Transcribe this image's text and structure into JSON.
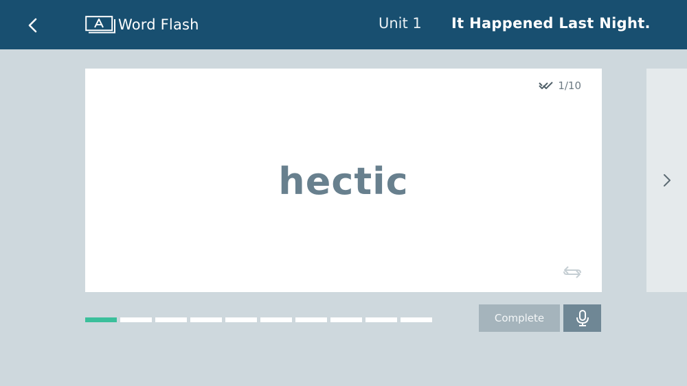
{
  "header": {
    "app_title": "Word Flash",
    "unit_label": "Unit 1",
    "unit_title": "It Happened Last Night.",
    "icons": {
      "back": "chevron-left-icon",
      "brand": "flashcard-icon"
    }
  },
  "card": {
    "word": "hectic",
    "counter": "1/10",
    "icons": {
      "counter": "double-check-icon",
      "flip": "flip-arrows-icon"
    }
  },
  "progress": {
    "total": 10,
    "completed": 1
  },
  "actions": {
    "complete_label": "Complete",
    "mic_icon": "microphone-icon"
  },
  "colors": {
    "header_bg": "#184f70",
    "page_bg": "#ced8dd",
    "progress_done": "#3bbf9b",
    "progress_todo": "#ffffff",
    "word_text": "#68808e",
    "complete_bg": "#a5b4bc",
    "mic_bg": "#6f8795"
  }
}
